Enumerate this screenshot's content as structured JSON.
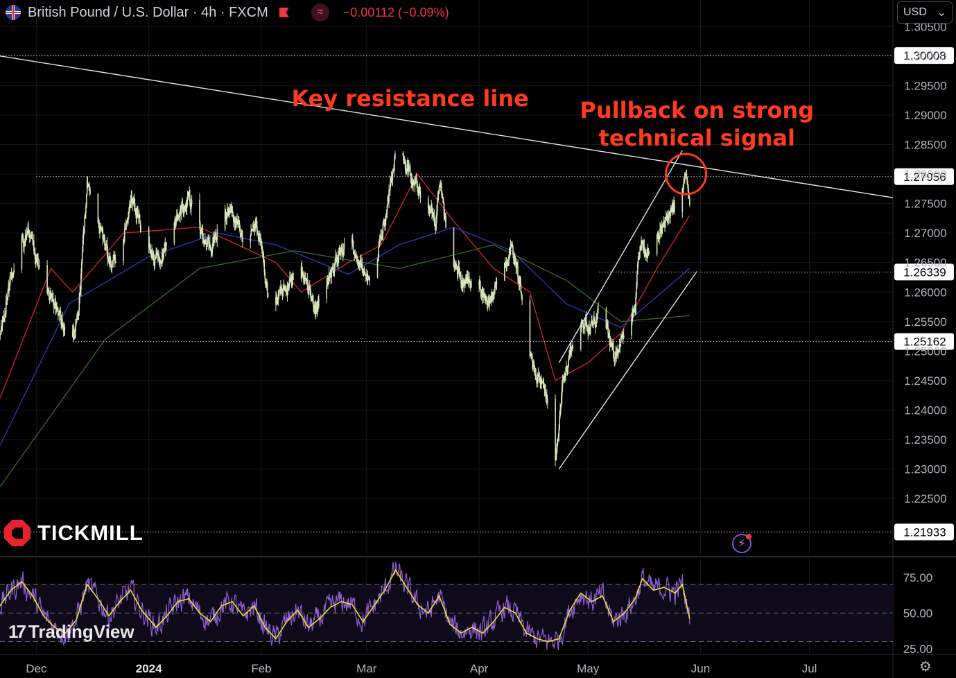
{
  "header": {
    "symbol_title": "British Pound / U.S. Dollar · 4h · FXCM",
    "change": "−0.00112 (−0.09%)",
    "currency": "USD",
    "currency_chevron": "⌄"
  },
  "icons": {
    "flag": "uk-us-flag-icon",
    "flagmark": "red-flag-icon",
    "wave": "indicator-wave-icon",
    "bolt": "lightning-icon",
    "gear": "settings-gear-icon"
  },
  "logos": {
    "tickmill": "TICKMILL",
    "tradingview": "TradingView",
    "tradingview_mark": "17"
  },
  "annotations": {
    "key_resistance": "Key resistance line",
    "pullback_line1": "Pullback on strong",
    "pullback_line2": "technical signal"
  },
  "colors": {
    "background": "#000000",
    "candle": "#d6e6b8",
    "ma_fast": "#c8222c",
    "ma_mid": "#2835b4",
    "ma_slow": "#2f6a22",
    "trend_lines": "#e6e6e6",
    "annotation": "#ff3b1f",
    "rsi_line": "#8f5fd1",
    "rsi_signal": "#e6e236",
    "negative": "#f23645"
  },
  "chart_data": {
    "type": "candlestick",
    "instrument": "British Pound / U.S. Dollar",
    "timeframe": "4h",
    "x_tick_labels": [
      "Dec",
      "2024",
      "Feb",
      "Mar",
      "Apr",
      "May",
      "Jun",
      "Jul"
    ],
    "x_ticks": [
      "2023-12-01",
      "2024-01-01",
      "2024-02-01",
      "2024-03-01",
      "2024-04-01",
      "2024-05-01",
      "2024-06-01",
      "2024-07-01"
    ],
    "x_range": [
      "2023-11-21",
      "2024-07-24"
    ],
    "y_range": [
      1.2155,
      1.3095
    ],
    "y_ticks": [
      1.225,
      1.23,
      1.235,
      1.24,
      1.245,
      1.25,
      1.255,
      1.26,
      1.265,
      1.27,
      1.275,
      1.28,
      1.285,
      1.29,
      1.295,
      1.3,
      1.305
    ],
    "y_tick_labels": [
      "1.22500",
      "1.23000",
      "1.23500",
      "1.24000",
      "1.24500",
      "1.25000",
      "1.25500",
      "1.26000",
      "1.26500",
      "1.27000",
      "1.27500",
      "1.28000",
      "1.28500",
      "1.29000",
      "1.29500",
      "1.30000",
      "1.30500"
    ],
    "price_path": [
      [
        "2023-11-21",
        1.252
      ],
      [
        "2023-11-24",
        1.262
      ],
      [
        "2023-11-27",
        1.268
      ],
      [
        "2023-11-29",
        1.27
      ],
      [
        "2023-12-01",
        1.266
      ],
      [
        "2023-12-03",
        1.262
      ],
      [
        "2023-12-06",
        1.258
      ],
      [
        "2023-12-08",
        1.255
      ],
      [
        "2023-12-11",
        1.252
      ],
      [
        "2023-12-13",
        1.26
      ],
      [
        "2023-12-15",
        1.278
      ],
      [
        "2023-12-18",
        1.272
      ],
      [
        "2023-12-20",
        1.268
      ],
      [
        "2023-12-22",
        1.264
      ],
      [
        "2023-12-25",
        1.269
      ],
      [
        "2023-12-27",
        1.276
      ],
      [
        "2023-12-29",
        1.273
      ],
      [
        "2024-01-02",
        1.266
      ],
      [
        "2024-01-04",
        1.265
      ],
      [
        "2024-01-06",
        1.268
      ],
      [
        "2024-01-09",
        1.273
      ],
      [
        "2024-01-12",
        1.276
      ],
      [
        "2024-01-15",
        1.27
      ],
      [
        "2024-01-18",
        1.268
      ],
      [
        "2024-01-21",
        1.272
      ],
      [
        "2024-01-24",
        1.274
      ],
      [
        "2024-01-27",
        1.27
      ],
      [
        "2024-01-30",
        1.272
      ],
      [
        "2024-02-01",
        1.269
      ],
      [
        "2024-02-02",
        1.262
      ],
      [
        "2024-02-04",
        1.256
      ],
      [
        "2024-02-06",
        1.259
      ],
      [
        "2024-02-09",
        1.262
      ],
      [
        "2024-02-12",
        1.264
      ],
      [
        "2024-02-14",
        1.26
      ],
      [
        "2024-02-16",
        1.257
      ],
      [
        "2024-02-18",
        1.26
      ],
      [
        "2024-02-21",
        1.264
      ],
      [
        "2024-02-23",
        1.267
      ],
      [
        "2024-02-26",
        1.268
      ],
      [
        "2024-02-28",
        1.265
      ],
      [
        "2024-03-01",
        1.262
      ],
      [
        "2024-03-03",
        1.264
      ],
      [
        "2024-03-05",
        1.27
      ],
      [
        "2024-03-07",
        1.276
      ],
      [
        "2024-03-09",
        1.284
      ],
      [
        "2024-03-10",
        1.287
      ],
      [
        "2024-03-12",
        1.281
      ],
      [
        "2024-03-14",
        1.278
      ],
      [
        "2024-03-17",
        1.276
      ],
      [
        "2024-03-20",
        1.272
      ],
      [
        "2024-03-21",
        1.278
      ],
      [
        "2024-03-23",
        1.271
      ],
      [
        "2024-03-25",
        1.265
      ],
      [
        "2024-03-27",
        1.262
      ],
      [
        "2024-03-29",
        1.262
      ],
      [
        "2024-04-01",
        1.261
      ],
      [
        "2024-04-02",
        1.26
      ],
      [
        "2024-04-04",
        1.258
      ],
      [
        "2024-04-06",
        1.261
      ],
      [
        "2024-04-08",
        1.265
      ],
      [
        "2024-04-10",
        1.268
      ],
      [
        "2024-04-11",
        1.265
      ],
      [
        "2024-04-13",
        1.258
      ],
      [
        "2024-04-15",
        1.25
      ],
      [
        "2024-04-17",
        1.246
      ],
      [
        "2024-04-19",
        1.243
      ],
      [
        "2024-04-21",
        1.238
      ],
      [
        "2024-04-22",
        1.232
      ],
      [
        "2024-04-24",
        1.244
      ],
      [
        "2024-04-26",
        1.25
      ],
      [
        "2024-04-28",
        1.253
      ],
      [
        "2024-04-30",
        1.255
      ],
      [
        "2024-05-02",
        1.254
      ],
      [
        "2024-05-04",
        1.256
      ],
      [
        "2024-05-06",
        1.254
      ],
      [
        "2024-05-08",
        1.249
      ],
      [
        "2024-05-10",
        1.252
      ],
      [
        "2024-05-12",
        1.253
      ],
      [
        "2024-05-14",
        1.257
      ],
      [
        "2024-05-15",
        1.266
      ],
      [
        "2024-05-16",
        1.268
      ],
      [
        "2024-05-18",
        1.267
      ],
      [
        "2024-05-20",
        1.27
      ],
      [
        "2024-05-22",
        1.271
      ],
      [
        "2024-05-23",
        1.273
      ],
      [
        "2024-05-25",
        1.274
      ],
      [
        "2024-05-27",
        1.277
      ],
      [
        "2024-05-28",
        1.28
      ],
      [
        "2024-05-29",
        1.274
      ]
    ],
    "moving_averages": [
      {
        "color": "#c8222c",
        "points": [
          [
            "2023-11-21",
            1.242
          ],
          [
            "2023-12-05",
            1.264
          ],
          [
            "2023-12-11",
            1.26
          ],
          [
            "2023-12-25",
            1.27
          ],
          [
            "2024-01-15",
            1.271
          ],
          [
            "2024-02-05",
            1.265
          ],
          [
            "2024-02-12",
            1.26
          ],
          [
            "2024-02-25",
            1.265
          ],
          [
            "2024-03-05",
            1.268
          ],
          [
            "2024-03-15",
            1.28
          ],
          [
            "2024-03-25",
            1.272
          ],
          [
            "2024-04-05",
            1.264
          ],
          [
            "2024-04-15",
            1.26
          ],
          [
            "2024-04-22",
            1.245
          ],
          [
            "2024-05-01",
            1.248
          ],
          [
            "2024-05-10",
            1.253
          ],
          [
            "2024-05-20",
            1.264
          ],
          [
            "2024-05-29",
            1.273
          ]
        ]
      },
      {
        "color": "#2835b4",
        "points": [
          [
            "2023-11-21",
            1.234
          ],
          [
            "2023-12-10",
            1.258
          ],
          [
            "2024-01-01",
            1.266
          ],
          [
            "2024-01-20",
            1.27
          ],
          [
            "2024-02-05",
            1.268
          ],
          [
            "2024-02-25",
            1.263
          ],
          [
            "2024-03-10",
            1.268
          ],
          [
            "2024-03-25",
            1.271
          ],
          [
            "2024-04-10",
            1.267
          ],
          [
            "2024-04-25",
            1.258
          ],
          [
            "2024-05-10",
            1.254
          ],
          [
            "2024-05-29",
            1.264
          ]
        ]
      },
      {
        "color": "#2f6a22",
        "points": [
          [
            "2023-11-21",
            1.227
          ],
          [
            "2023-12-20",
            1.252
          ],
          [
            "2024-01-15",
            1.264
          ],
          [
            "2024-02-10",
            1.267
          ],
          [
            "2024-03-10",
            1.264
          ],
          [
            "2024-04-05",
            1.268
          ],
          [
            "2024-04-25",
            1.262
          ],
          [
            "2024-05-10",
            1.255
          ],
          [
            "2024-05-29",
            1.256
          ]
        ]
      }
    ],
    "trend_lines": [
      {
        "name": "resistance",
        "from": [
          "2023-11-21",
          1.3
        ],
        "to": [
          "2024-07-24",
          1.276
        ]
      },
      {
        "name": "channel-upper",
        "from": [
          "2024-04-23",
          1.248
        ],
        "to": [
          "2024-05-27",
          1.284
        ]
      },
      {
        "name": "channel-lower",
        "from": [
          "2024-04-23",
          1.23
        ],
        "to": [
          "2024-05-31",
          1.2635
        ]
      }
    ],
    "horizontal_levels": [
      {
        "value": 1.30008,
        "label": "1.30008",
        "from": "2023-11-21"
      },
      {
        "value": 1.27956,
        "label": "1.27956",
        "from": "2023-12-01"
      },
      {
        "value": 1.26339,
        "label": "1.26339",
        "from": "2024-05-04"
      },
      {
        "value": 1.25162,
        "label": "1.25162",
        "from": "2023-12-11"
      },
      {
        "value": 1.21933,
        "label": "1.21933",
        "from": "2023-11-21"
      }
    ],
    "highlight_circle": {
      "x": "2024-05-28",
      "y": 1.28
    },
    "annotations": [
      {
        "key": "key_resistance",
        "x": "2024-03-13",
        "y": 1.2915
      },
      {
        "key": "pullback_line1",
        "x": "2024-05-31",
        "y": 1.2895
      },
      {
        "key": "pullback_line2",
        "x": "2024-05-31",
        "y": 1.2848
      }
    ],
    "rsi": {
      "y_range": [
        22,
        88
      ],
      "y_ticks": [
        25,
        50,
        75
      ],
      "y_tick_labels": [
        "25.00",
        "50.00",
        "75.00"
      ],
      "levels": [
        30,
        50,
        70
      ],
      "series": [
        [
          "2023-11-21",
          55
        ],
        [
          "2023-11-24",
          66
        ],
        [
          "2023-11-27",
          72
        ],
        [
          "2023-11-30",
          62
        ],
        [
          "2023-12-03",
          48
        ],
        [
          "2023-12-06",
          40
        ],
        [
          "2023-12-09",
          36
        ],
        [
          "2023-12-12",
          45
        ],
        [
          "2023-12-15",
          70
        ],
        [
          "2023-12-18",
          60
        ],
        [
          "2023-12-21",
          48
        ],
        [
          "2023-12-24",
          58
        ],
        [
          "2023-12-27",
          66
        ],
        [
          "2023-12-30",
          52
        ],
        [
          "2024-01-03",
          40
        ],
        [
          "2024-01-06",
          48
        ],
        [
          "2024-01-09",
          58
        ],
        [
          "2024-01-12",
          60
        ],
        [
          "2024-01-15",
          50
        ],
        [
          "2024-01-18",
          44
        ],
        [
          "2024-01-21",
          55
        ],
        [
          "2024-01-24",
          58
        ],
        [
          "2024-01-27",
          48
        ],
        [
          "2024-01-30",
          55
        ],
        [
          "2024-02-02",
          40
        ],
        [
          "2024-02-05",
          32
        ],
        [
          "2024-02-08",
          44
        ],
        [
          "2024-02-11",
          52
        ],
        [
          "2024-02-14",
          40
        ],
        [
          "2024-02-17",
          46
        ],
        [
          "2024-02-20",
          54
        ],
        [
          "2024-02-23",
          58
        ],
        [
          "2024-02-26",
          56
        ],
        [
          "2024-02-29",
          44
        ],
        [
          "2024-03-03",
          55
        ],
        [
          "2024-03-06",
          66
        ],
        [
          "2024-03-09",
          80
        ],
        [
          "2024-03-12",
          68
        ],
        [
          "2024-03-15",
          56
        ],
        [
          "2024-03-18",
          50
        ],
        [
          "2024-03-21",
          62
        ],
        [
          "2024-03-24",
          42
        ],
        [
          "2024-03-27",
          36
        ],
        [
          "2024-03-30",
          40
        ],
        [
          "2024-04-02",
          36
        ],
        [
          "2024-04-05",
          44
        ],
        [
          "2024-04-08",
          54
        ],
        [
          "2024-04-11",
          50
        ],
        [
          "2024-04-14",
          36
        ],
        [
          "2024-04-17",
          32
        ],
        [
          "2024-04-20",
          30
        ],
        [
          "2024-04-23",
          32
        ],
        [
          "2024-04-26",
          52
        ],
        [
          "2024-04-29",
          64
        ],
        [
          "2024-05-02",
          58
        ],
        [
          "2024-05-05",
          62
        ],
        [
          "2024-05-08",
          44
        ],
        [
          "2024-05-11",
          50
        ],
        [
          "2024-05-14",
          60
        ],
        [
          "2024-05-16",
          74
        ],
        [
          "2024-05-19",
          66
        ],
        [
          "2024-05-22",
          68
        ],
        [
          "2024-05-25",
          64
        ],
        [
          "2024-05-27",
          70
        ],
        [
          "2024-05-29",
          46
        ]
      ]
    }
  }
}
